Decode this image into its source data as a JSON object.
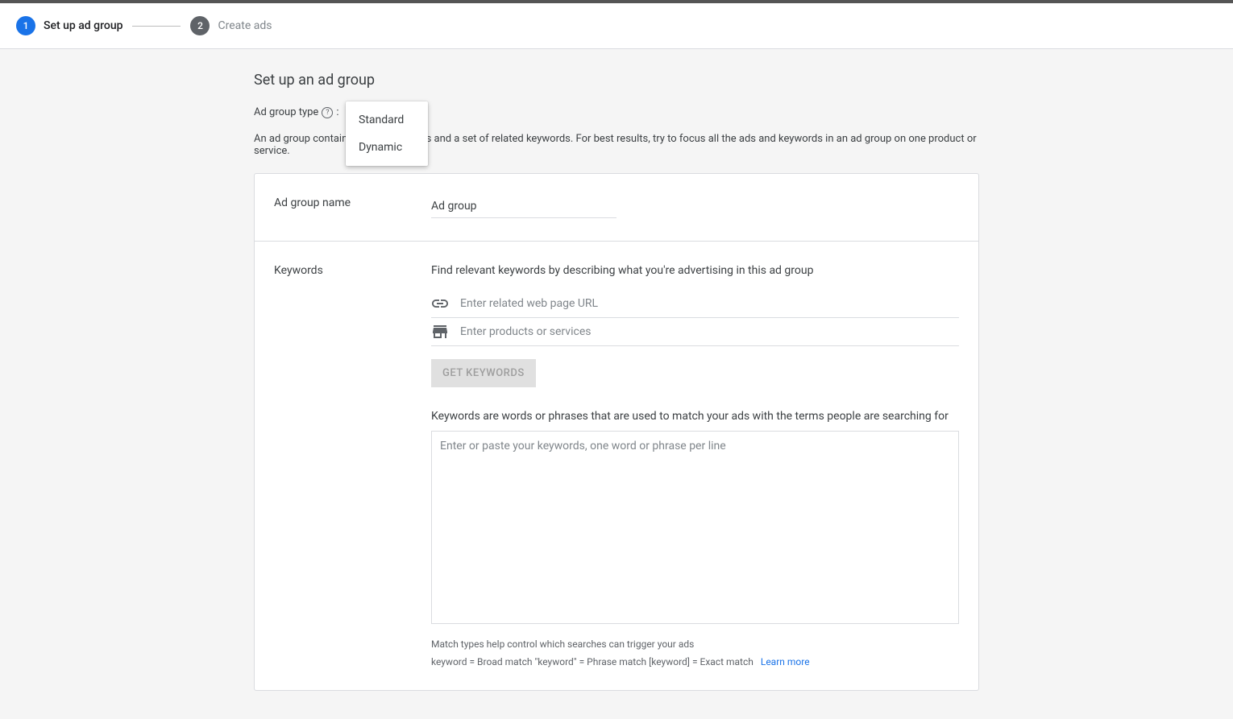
{
  "stepper": {
    "step1_num": "1",
    "step1_label": "Set up ad group",
    "step2_num": "2",
    "step2_label": "Create ads"
  },
  "page_title": "Set up an ad group",
  "adgroup_type_label": "Ad group type",
  "adgroup_type_colon": ":",
  "dropdown": {
    "opt_standard": "Standard",
    "opt_dynamic": "Dynamic"
  },
  "description": "An ad group contains one or more ads and a set of related keywords. For best results, try to focus all the ads and keywords in an ad group on one product or service.",
  "section_name_label": "Ad group name",
  "name_input_value": "Ad group",
  "section_keywords_label": "Keywords",
  "keywords_desc": "Find relevant keywords by describing what you're advertising in this ad group",
  "url_placeholder": "Enter related web page URL",
  "products_placeholder": "Enter products or services",
  "get_keywords_btn": "GET KEYWORDS",
  "keywords_subdesc": "Keywords are words or phrases that are used to match your ads with the terms people are searching for",
  "keywords_textarea_placeholder": "Enter or paste your keywords, one word or phrase per line",
  "match_help_1": "Match types help control which searches can trigger your ads",
  "match_help_2": "keyword = Broad match   \"keyword\" = Phrase match   [keyword] = Exact match",
  "learn_more": "Learn more"
}
